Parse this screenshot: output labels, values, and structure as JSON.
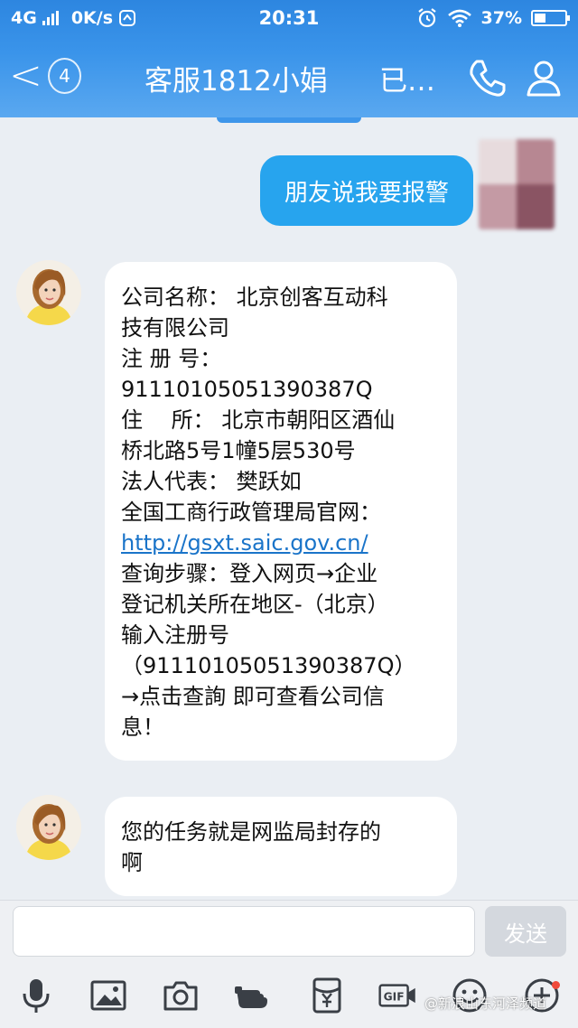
{
  "status_bar": {
    "network": "4G",
    "speed": "0K/s",
    "time": "20:31",
    "battery_percent": "37%",
    "battery_level": 0.37
  },
  "header": {
    "back_badge": "4",
    "title": "客服1812小娟",
    "status": "已…"
  },
  "messages": [
    {
      "direction": "out",
      "text": "朋友说我要报警"
    },
    {
      "direction": "in",
      "lines": [
        "公司名称： 北京创客互动科",
        "技有限公司",
        "注 册 号：",
        "91110105051390387Q",
        "住　 所： 北京市朝阳区酒仙",
        "桥北路5号1幢5层530号",
        "法人代表： 樊跃如",
        "全国工商行政管理局官网：",
        "http://gsxt.saic.gov.cn/",
        "查询步骤：登入网页→企业",
        "登记机关所在地区-（北京）",
        "输入注册号",
        "（91110105051390387Q）",
        "→点击查詢 即可查看公司信",
        "息！"
      ]
    },
    {
      "direction": "in",
      "lines": [
        "您的任务就是网监局封存的",
        "啊"
      ]
    }
  ],
  "composer": {
    "input_value": "",
    "send_label": "发送"
  },
  "toolbar": {
    "icons": [
      "microphone-icon",
      "image-icon",
      "camera-icon",
      "hand-icon",
      "red-packet-icon",
      "gif-icon",
      "emoji-icon",
      "more-icon"
    ],
    "gif_label": "GIF"
  },
  "watermark": "@新浪山东河泽频道",
  "colors": {
    "header_blue": "#3a94ea",
    "outgoing_bubble": "#27a4ee",
    "link": "#1a74c9",
    "notification_dot": "#f04a3a"
  }
}
